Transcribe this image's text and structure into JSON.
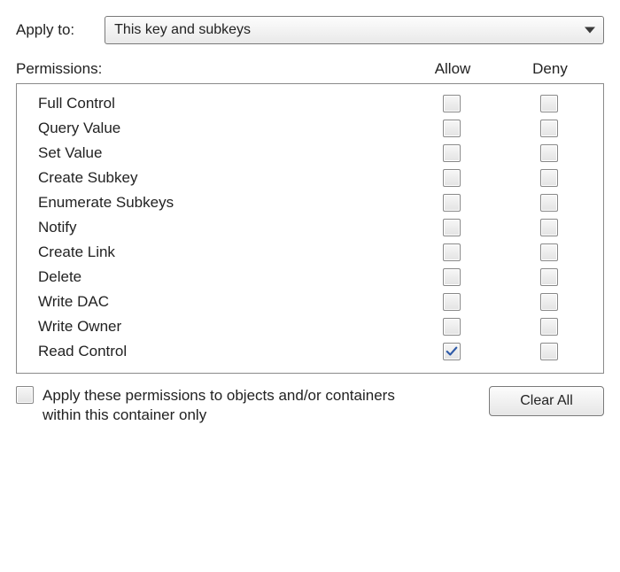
{
  "applyTo": {
    "label": "Apply to:",
    "selected": "This key and subkeys"
  },
  "permissionsLabel": "Permissions:",
  "columns": {
    "allow": "Allow",
    "deny": "Deny"
  },
  "permissions": [
    {
      "name": "Full Control",
      "allow": false,
      "deny": false
    },
    {
      "name": "Query Value",
      "allow": false,
      "deny": false
    },
    {
      "name": "Set Value",
      "allow": false,
      "deny": false
    },
    {
      "name": "Create Subkey",
      "allow": false,
      "deny": false
    },
    {
      "name": "Enumerate Subkeys",
      "allow": false,
      "deny": false
    },
    {
      "name": "Notify",
      "allow": false,
      "deny": false
    },
    {
      "name": "Create Link",
      "allow": false,
      "deny": false
    },
    {
      "name": "Delete",
      "allow": false,
      "deny": false
    },
    {
      "name": "Write DAC",
      "allow": false,
      "deny": false
    },
    {
      "name": "Write Owner",
      "allow": false,
      "deny": false
    },
    {
      "name": "Read Control",
      "allow": true,
      "deny": false
    }
  ],
  "inheritOnly": {
    "label": "Apply these permissions to objects and/or containers within this container only",
    "checked": false
  },
  "clearAllLabel": "Clear All"
}
